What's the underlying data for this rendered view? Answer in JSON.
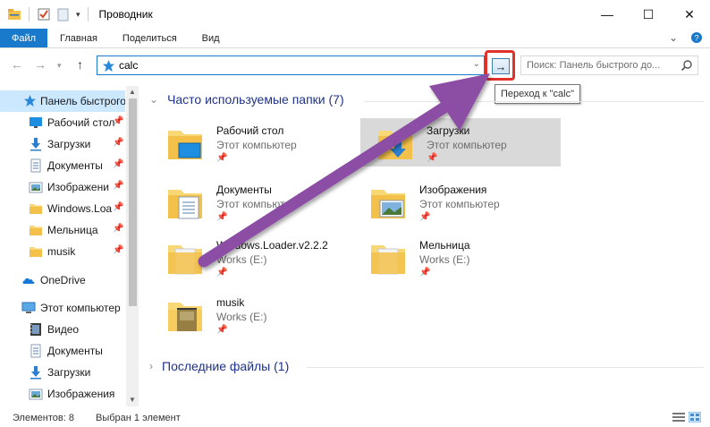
{
  "window": {
    "title": "Проводник",
    "minimize": "—",
    "maximize": "☐",
    "close": "✕"
  },
  "ribbon": {
    "tabs": [
      "Файл",
      "Главная",
      "Поделиться",
      "Вид"
    ],
    "collapse_icon": "chevron-down-icon",
    "help_icon": "help-icon"
  },
  "address": {
    "value": "calc",
    "search_placeholder": "Поиск: Панель быстрого до...",
    "tooltip": "Переход к \"calc\""
  },
  "sidebar": {
    "items": [
      {
        "label": "Панель быстрого",
        "icon": "star-icon",
        "pinned": false
      },
      {
        "label": "Рабочий стол",
        "icon": "desktop-icon",
        "pinned": true
      },
      {
        "label": "Загрузки",
        "icon": "download-icon",
        "pinned": true
      },
      {
        "label": "Документы",
        "icon": "documents-icon",
        "pinned": true
      },
      {
        "label": "Изображени",
        "icon": "pictures-icon",
        "pinned": true
      },
      {
        "label": "Windows.Loa",
        "icon": "folder-icon",
        "pinned": true
      },
      {
        "label": "Мельница",
        "icon": "folder-icon",
        "pinned": true
      },
      {
        "label": "musik",
        "icon": "folder-icon",
        "pinned": true
      },
      {
        "label": "OneDrive",
        "icon": "cloud-icon",
        "pinned": false
      },
      {
        "label": "Этот компьютер",
        "icon": "computer-icon",
        "pinned": false
      },
      {
        "label": "Видео",
        "icon": "video-icon",
        "pinned": false
      },
      {
        "label": "Документы",
        "icon": "documents-icon",
        "pinned": false
      },
      {
        "label": "Загрузки",
        "icon": "download-icon",
        "pinned": false
      },
      {
        "label": "Изображения",
        "icon": "pictures-icon",
        "pinned": false
      }
    ]
  },
  "main": {
    "frequent_title": "Часто используемые папки (7)",
    "recent_title": "Последние файлы (1)",
    "folders": [
      {
        "name": "Рабочий стол",
        "location": "Этот компьютер"
      },
      {
        "name": "Загрузки",
        "location": "Этот компьютер"
      },
      {
        "name": "Документы",
        "location": "Этот компьютер"
      },
      {
        "name": "Изображения",
        "location": "Этот компьютер"
      },
      {
        "name": "Windows.Loader.v2.2.2",
        "location": "Works (E:)"
      },
      {
        "name": "Мельница",
        "location": "Works (E:)"
      },
      {
        "name": "musik",
        "location": "Works (E:)"
      }
    ]
  },
  "status": {
    "count": "Элементов: 8",
    "selected": "Выбран 1 элемент"
  },
  "colors": {
    "accent": "#1979ca",
    "highlight_box": "#e0312b",
    "arrow": "#8c4ea5",
    "group_title": "#1e3287"
  }
}
